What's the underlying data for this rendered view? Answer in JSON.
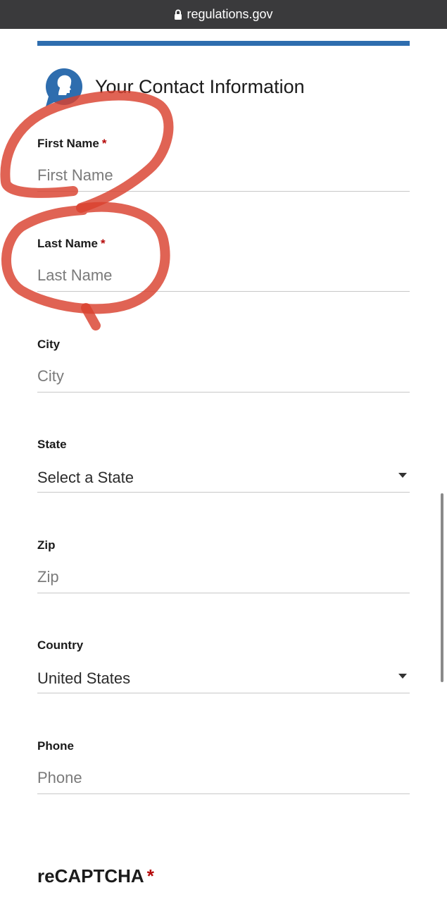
{
  "browser": {
    "url": "regulations.gov"
  },
  "header": {
    "title": "Your Contact Information"
  },
  "fields": {
    "first_name": {
      "label": "First Name",
      "required_mark": "*",
      "placeholder": "First Name",
      "value": ""
    },
    "last_name": {
      "label": "Last Name",
      "required_mark": "*",
      "placeholder": "Last Name",
      "value": ""
    },
    "city": {
      "label": "City",
      "placeholder": "City",
      "value": ""
    },
    "state": {
      "label": "State",
      "selected": "Select a State"
    },
    "zip": {
      "label": "Zip",
      "placeholder": "Zip",
      "value": ""
    },
    "country": {
      "label": "Country",
      "selected": "United States"
    },
    "phone": {
      "label": "Phone",
      "placeholder": "Phone",
      "value": ""
    }
  },
  "recaptcha": {
    "heading": "reCAPTCHA",
    "required_mark": "*"
  },
  "colors": {
    "accent": "#2e6dae",
    "required": "#b50909",
    "annotation": "#d9412e",
    "url_bar": "#3a3a3c"
  },
  "icons": {
    "url_lock": "lock-icon",
    "header": "person-speech-bubble-icon",
    "select_caret": "caret-down-icon"
  }
}
